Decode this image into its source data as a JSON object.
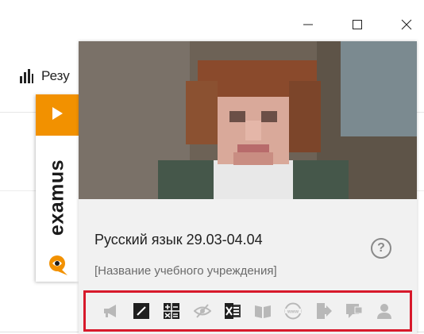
{
  "window": {
    "controls": [
      {
        "name": "minimize",
        "icon": "minimize-icon"
      },
      {
        "name": "maximize",
        "icon": "maximize-icon"
      },
      {
        "name": "close",
        "icon": "close-icon"
      }
    ]
  },
  "background": {
    "results_label": "Резу",
    "results_icon": "bar-chart-icon"
  },
  "examus": {
    "brand": "examus",
    "play_icon": "play-icon",
    "logo_icon": "examus-logo-icon",
    "accent_color": "#f29100"
  },
  "panel": {
    "course_title": "Русский язык 29.03-04.04",
    "organization": "[Название учебного учреждения]",
    "help_icon": "help-icon",
    "help_label": "?",
    "highlight_color": "#d7192b"
  },
  "toolbar": {
    "tools": [
      {
        "icon": "megaphone-icon",
        "active": false
      },
      {
        "icon": "notepad-icon",
        "active": true
      },
      {
        "icon": "calculator-icon",
        "active": true
      },
      {
        "icon": "hidden-eye-icon",
        "active": false
      },
      {
        "icon": "excel-icon",
        "active": true
      },
      {
        "icon": "book-icon",
        "active": false
      },
      {
        "icon": "www-icon",
        "active": false
      },
      {
        "icon": "exit-door-icon",
        "active": false
      },
      {
        "icon": "chat-icon",
        "active": false
      },
      {
        "icon": "user-icon",
        "active": false
      }
    ]
  }
}
